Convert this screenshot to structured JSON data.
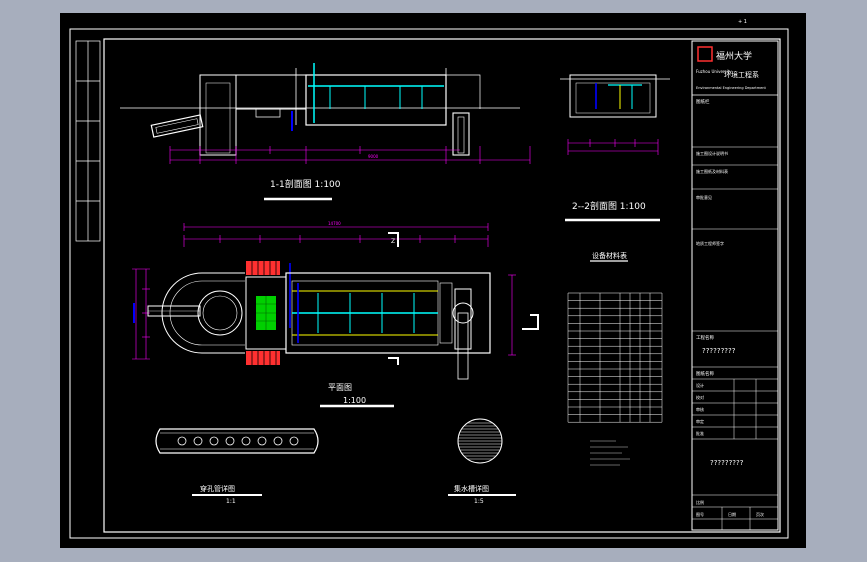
{
  "drawing": {
    "title_1_1": "1-1剖面图 1:100",
    "title_2_2": "2--2剖面图 1:100",
    "plan_title": "平面图",
    "plan_scale": "1:100",
    "pipe_title": "穿孔管详图",
    "pipe_scale": "1:1",
    "grille_title": "集水槽详图",
    "grille_scale": "1:5",
    "table_title": "设备材料表",
    "section_mark": "Z",
    "dim_9000": "9000",
    "dim_14700": "14700"
  },
  "title_block": {
    "university_cn": "福州大学",
    "university_en": "Fuzhou University",
    "department_cn": "环境工程系",
    "department_en": "Environmental Engineering Department",
    "rows": [
      "图纸栏",
      "施工图设计说明书",
      "施工图纸及材料表",
      "审批意见",
      "地质工程师签字"
    ],
    "project_label": "工程名称",
    "project_value": "?????????",
    "drawing_label": "图纸名称",
    "sign_rows": [
      "设计",
      "校对",
      "审核",
      "审定",
      "批准"
    ],
    "drawing_value": "?????????",
    "bottom_rows": [
      "比例",
      "图号"
    ],
    "bottom_right": [
      "日期",
      "页次"
    ]
  },
  "colors": {
    "background": "#a7aebd",
    "sheet": "#000000",
    "line_white": "#ffffff",
    "dimension": "#ff00ff",
    "water": "#00ffff",
    "pipe": "#0000ff",
    "equipment_green": "#00ff00",
    "equipment_red": "#ff3030",
    "yellow": "#ffff00"
  }
}
